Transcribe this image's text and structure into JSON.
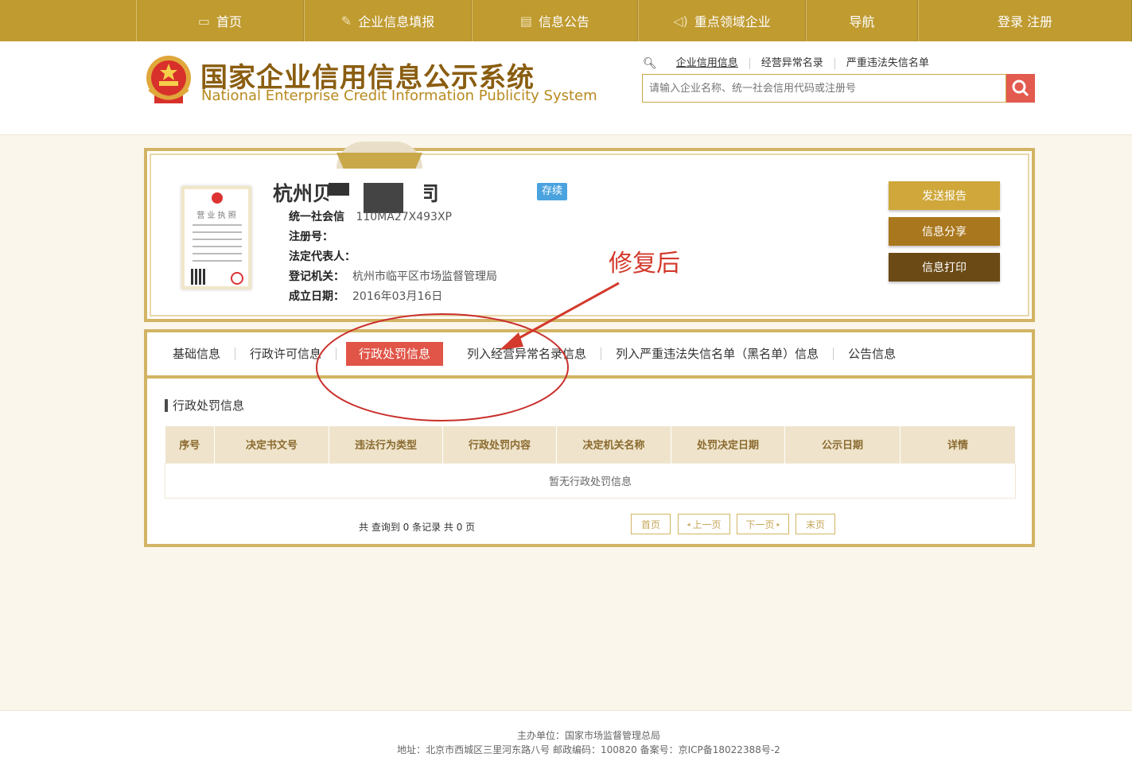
{
  "nav": {
    "items": [
      {
        "label": "首页",
        "icon": "monitor-icon"
      },
      {
        "label": "企业信息填报",
        "icon": "edit-icon"
      },
      {
        "label": "信息公告",
        "icon": "document-icon"
      },
      {
        "label": "重点领域企业",
        "icon": "speaker-icon"
      },
      {
        "label": "导航",
        "icon": ""
      },
      {
        "label": "登录  注册",
        "icon": ""
      }
    ]
  },
  "header": {
    "title": "国家企业信用信息公示系统",
    "subtitle": "National Enterprise Credit Information Publicity System",
    "search_tabs": [
      "企业信用信息",
      "经营异常名录",
      "严重违法失信名单"
    ],
    "search_placeholder": "请输入企业名称、统一社会信用代码或注册号"
  },
  "company": {
    "name": "杭州贝                  品有限公司",
    "status": "存续",
    "fields": [
      {
        "label": "统一社会信",
        "value": "                        110MA27X493XP"
      },
      {
        "label": "注册号：",
        "value": ""
      },
      {
        "label": "法定代表人：",
        "value": ""
      },
      {
        "label": "登记机关：",
        "value": "杭州市临平区市场监督管理局"
      },
      {
        "label": "成立日期：",
        "value": "2016年03月16日"
      }
    ],
    "license_title": "营 业 执 照",
    "buttons": [
      "发送报告",
      "信息分享",
      "信息打印"
    ],
    "annotation": "修复后"
  },
  "tabs": [
    "基础信息",
    "行政许可信息",
    "行政处罚信息",
    "列入经营异常名录信息",
    "列入严重违法失信名单（黑名单）信息",
    "公告信息"
  ],
  "active_tab": "行政处罚信息",
  "section": {
    "title": "行政处罚信息",
    "columns": [
      "序号",
      "决定书文号",
      "违法行为类型",
      "行政处罚内容",
      "决定机关名称",
      "处罚决定日期",
      "公示日期",
      "详情"
    ],
    "empty_text": "暂无行政处罚信息"
  },
  "pager": {
    "info": "共 查询到 0 条记录 共 0 页",
    "first": "首页",
    "prev": "上一页",
    "next": "下一页",
    "last": "末页"
  },
  "footer": {
    "line1": "主办单位：国家市场监督管理总局",
    "line2": "地址：北京市西城区三里河东路八号   邮政编码：100820   备案号：京ICP备18022388号-2"
  },
  "colors": {
    "gold": "#bf9b30",
    "accent_red": "#e05548",
    "status_blue": "#4aa3df"
  }
}
